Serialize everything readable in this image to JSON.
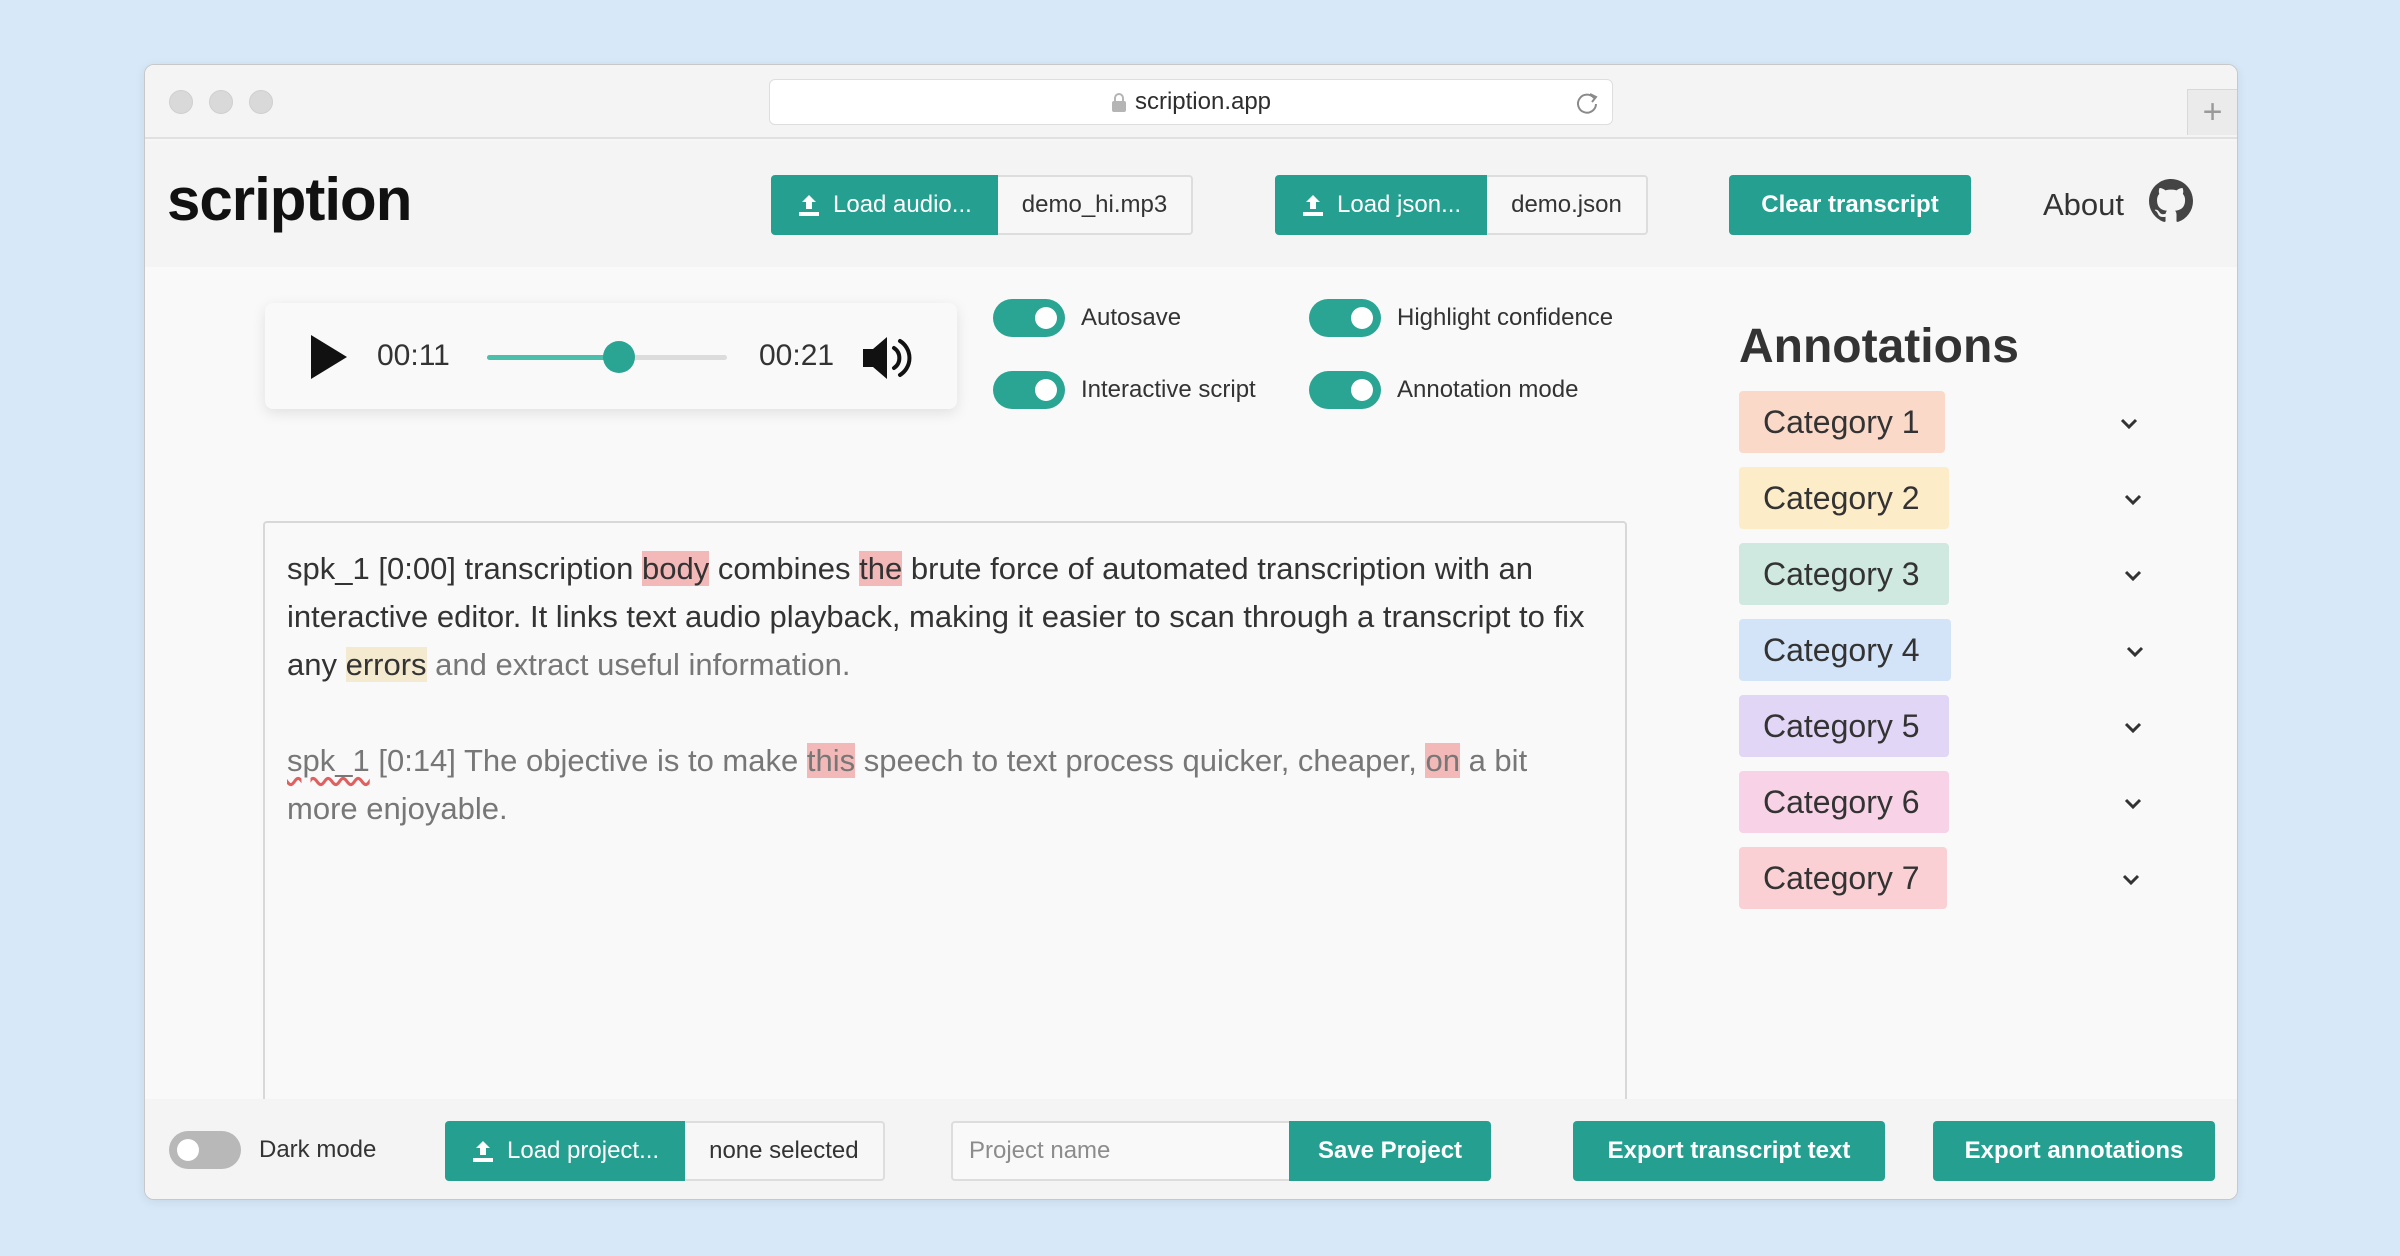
{
  "browser": {
    "url": "scription.app",
    "new_tab_label": "+"
  },
  "app": {
    "logo": "scription",
    "load_audio_label": "Load audio...",
    "audio_file": "demo_hi.mp3",
    "load_json_label": "Load json...",
    "json_file": "demo.json",
    "clear_label": "Clear transcript",
    "about_label": "About"
  },
  "player": {
    "current_time": "00:11",
    "duration": "00:21",
    "progress_fraction": 0.55
  },
  "toggles": {
    "autosave": "Autosave",
    "highlight_confidence": "Highlight confidence",
    "interactive_script": "Interactive script",
    "annotation_mode": "Annotation mode"
  },
  "transcript": {
    "p1": {
      "speaker": "spk_1",
      "time": "[0:00]",
      "t1": "transcription ",
      "w1": "body",
      "t2": " combines ",
      "w2": "the",
      "t3": " brute force of automated transcription with an interactive editor. It links text audio playback, making it easier to scan through a transcript to fix any ",
      "w3": "errors",
      "t4": " and extract useful information."
    },
    "p2": {
      "speaker": "spk_1",
      "time": " [0:14] The objective is to make ",
      "w1": "this",
      "t2": " speech to text process quicker, cheaper, ",
      "w2": "on",
      "t3": " a bit more enjoyable."
    }
  },
  "annotations": {
    "title": "Annotations",
    "categories": [
      {
        "label": "Category 1",
        "color": "#fbd9c9"
      },
      {
        "label": "Category 2",
        "color": "#fcecc8"
      },
      {
        "label": "Category 3",
        "color": "#cfe9e0"
      },
      {
        "label": "Category 4",
        "color": "#d4e4f8"
      },
      {
        "label": "Category 5",
        "color": "#e2d6f6"
      },
      {
        "label": "Category 6",
        "color": "#f8d2e6"
      },
      {
        "label": "Category 7",
        "color": "#fad0d4"
      }
    ]
  },
  "footer": {
    "dark_mode_label": "Dark mode",
    "load_project_label": "Load project...",
    "project_file": "none selected",
    "project_name_placeholder": "Project name",
    "save_label": "Save Project",
    "export_text_label": "Export transcript text",
    "export_annotations_label": "Export annotations"
  },
  "colors": {
    "accent": "#25a090",
    "highlight_low": "#f3b8b8",
    "highlight_mid": "#f3ead0"
  }
}
